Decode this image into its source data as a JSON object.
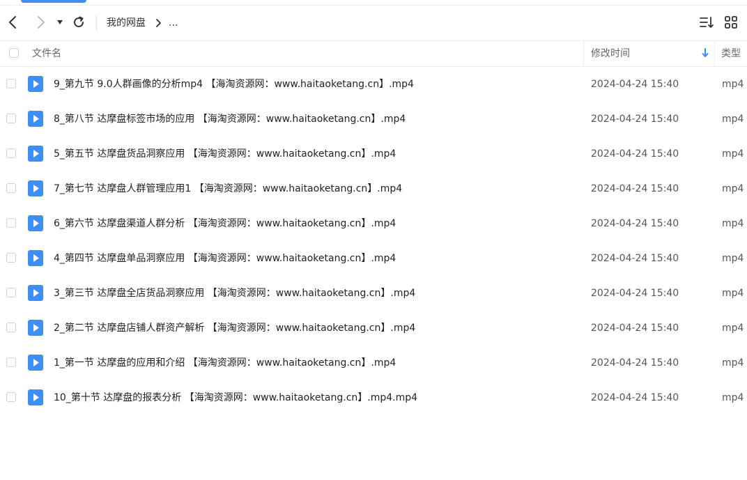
{
  "toolbar": {
    "breadcrumb_root": "我的网盘",
    "breadcrumb_more": "..."
  },
  "columns": {
    "name": "文件名",
    "modified": "修改时间",
    "type": "类型"
  },
  "colors": {
    "accent": "#3d8ef7",
    "video_icon": "#3d8ef7"
  },
  "files": [
    {
      "name": "9_第九节 9.0人群画像的分析mp4 【海淘资源网：www.haitaoketang.cn】.mp4",
      "time": "2024-04-24 15:40",
      "type": "mp4"
    },
    {
      "name": "8_第八节 达摩盘标签市场的应用 【海淘资源网：www.haitaoketang.cn】.mp4",
      "time": "2024-04-24 15:40",
      "type": "mp4"
    },
    {
      "name": "5_第五节 达摩盘货品洞察应用 【海淘资源网：www.haitaoketang.cn】.mp4",
      "time": "2024-04-24 15:40",
      "type": "mp4"
    },
    {
      "name": "7_第七节 达摩盘人群管理应用1 【海淘资源网：www.haitaoketang.cn】.mp4",
      "time": "2024-04-24 15:40",
      "type": "mp4"
    },
    {
      "name": "6_第六节 达摩盘渠道人群分析 【海淘资源网：www.haitaoketang.cn】.mp4",
      "time": "2024-04-24 15:40",
      "type": "mp4"
    },
    {
      "name": "4_第四节 达摩盘单品洞察应用 【海淘资源网：www.haitaoketang.cn】.mp4",
      "time": "2024-04-24 15:40",
      "type": "mp4"
    },
    {
      "name": "3_第三节 达摩盘全店货品洞察应用 【海淘资源网：www.haitaoketang.cn】.mp4",
      "time": "2024-04-24 15:40",
      "type": "mp4"
    },
    {
      "name": "2_第二节 达摩盘店铺人群资产解析 【海淘资源网：www.haitaoketang.cn】.mp4",
      "time": "2024-04-24 15:40",
      "type": "mp4"
    },
    {
      "name": "1_第一节 达摩盘的应用和介绍 【海淘资源网：www.haitaoketang.cn】.mp4",
      "time": "2024-04-24 15:40",
      "type": "mp4"
    },
    {
      "name": "10_第十节 达摩盘的报表分析 【海淘资源网：www.haitaoketang.cn】.mp4.mp4",
      "time": "2024-04-24 15:40",
      "type": "mp4"
    }
  ]
}
